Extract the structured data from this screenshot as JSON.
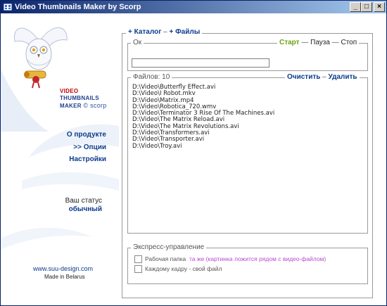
{
  "window": {
    "title": "Video Thumbnails Maker by Scorp",
    "minimize": "_",
    "maximize": "□",
    "close": "×"
  },
  "logo": {
    "line1": "VIDEO",
    "line2": "THUMBNAILS",
    "line3": "MAKER",
    "credit": "© scorp"
  },
  "nav": {
    "about": "О продукте",
    "options": ">> Опции",
    "settings": "Настройки"
  },
  "status": {
    "label": "Ваш статус",
    "value": "обычный"
  },
  "footer": {
    "site": "www.suu-design.com",
    "made": "Made in Belarus"
  },
  "top_links": {
    "catalog": "+ Каталог",
    "sep": "–",
    "files": "+ Файлы"
  },
  "progress": {
    "status_text": "Ок",
    "start": "Старт",
    "pause": "Пауза",
    "stop": "Стоп",
    "value": 0
  },
  "files": {
    "count_label": "Файлов: 10",
    "clear": "Очистить",
    "delete": "Удалить",
    "items": [
      "D:\\Video\\Butterfly Effect.avi",
      "D:\\Video\\I Robot.mkv",
      "D:\\Video\\Matrix.mp4",
      "D:\\Video\\Robotica_720.wmv",
      "D:\\Video\\Terminator 3 Rise Of The Machines.avi",
      "D:\\Video\\The Matrix Reload.avi",
      "D:\\Video\\The Matrix Revolutions.avi",
      "D:\\Video\\Transformers.avi",
      "D:\\Video\\Transporter.avi",
      "D:\\Video\\Troy.avi"
    ]
  },
  "express": {
    "title": "Экспресс-управление",
    "option1_label": "Рабочая папка",
    "option1_hint": "та же (картинка ложится рядом с видео-файлом)",
    "option1_checked": false,
    "option2_label": "Каждому кадру - свой файл",
    "option2_checked": false
  },
  "colors": {
    "titlebar_start": "#0a246a",
    "titlebar_end": "#a6caf0",
    "link_blue": "#0b3b8c",
    "start_green": "#6aa20e",
    "hint_purple": "#b44bd0",
    "logo_red": "#c00000"
  }
}
